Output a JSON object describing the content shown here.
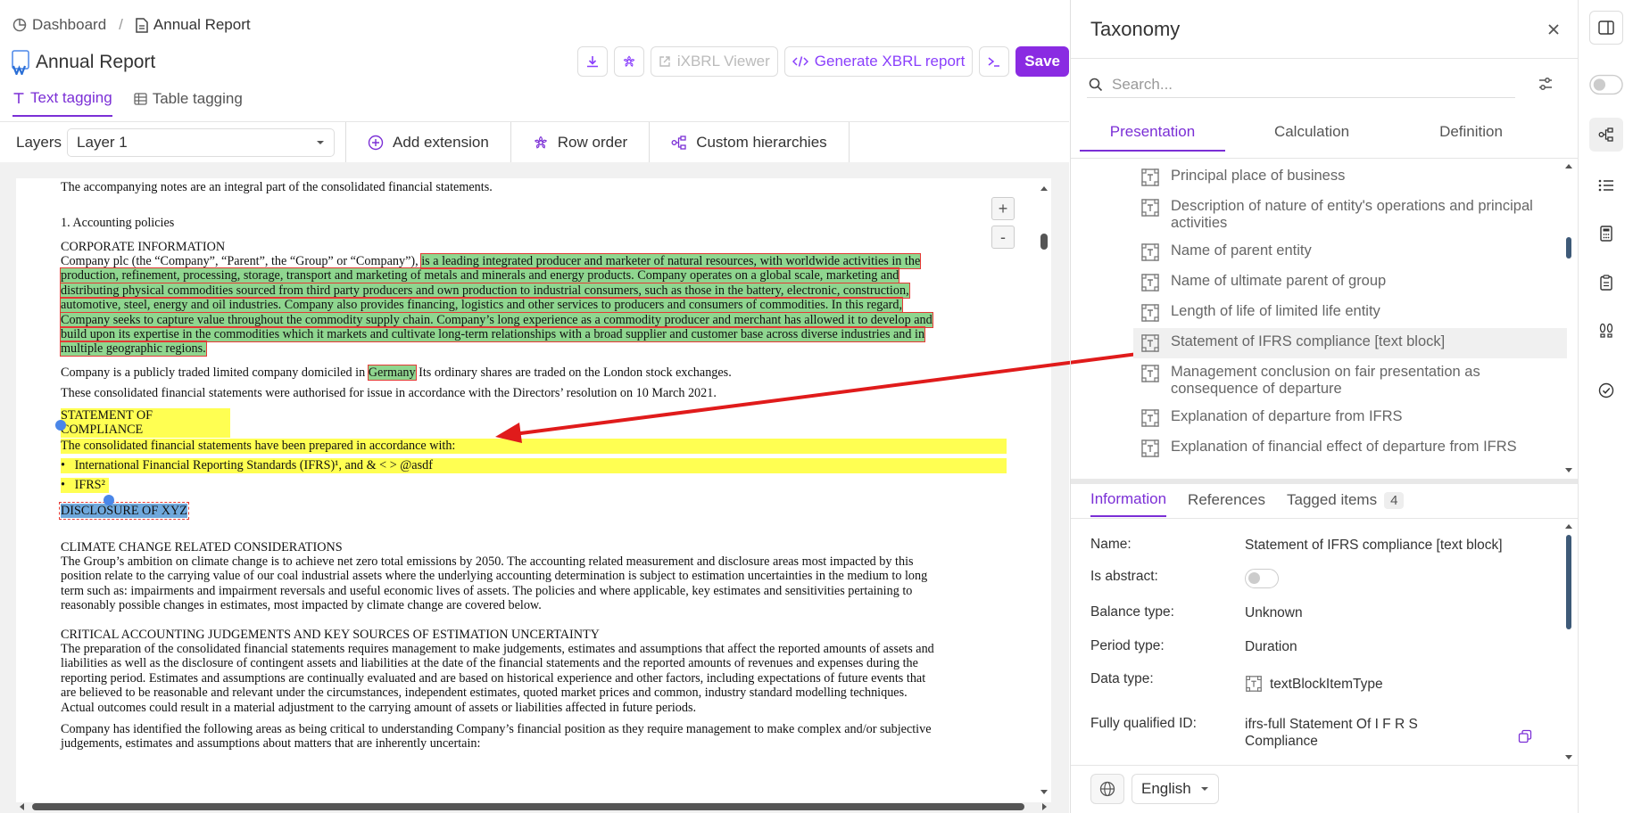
{
  "breadcrumb": {
    "home": "Dashboard",
    "separator": "/",
    "current": "Annual Report"
  },
  "header": {
    "title": "Annual Report"
  },
  "toolbar": {
    "download_icon": "download-icon",
    "settings_icon": "flower-icon",
    "ixbrl_label": "iXBRL Viewer",
    "generate_label": "Generate XBRL report",
    "terminal_icon": "terminal-icon",
    "save_label": "Save"
  },
  "tabs": [
    {
      "label": "Text tagging",
      "active": true
    },
    {
      "label": "Table tagging",
      "active": false
    }
  ],
  "layerbar": {
    "layers_label": "Layers",
    "layer_value": "Layer 1",
    "add_extension": "Add extension",
    "row_order": "Row order",
    "custom_hierarchies": "Custom hierarchies"
  },
  "document": {
    "p0": "The accompanying notes are an integral part of the consolidated financial statements.",
    "h1": "1. Accounting policies",
    "h_corp": "CORPORATE INFORMATION",
    "corp_pre": "Company plc (the “Company”, “Parent”, the “Group” or “Company”),",
    "corp_tag_l1": "is a leading integrated producer and marketer of natural resources, with worldwide activities in the",
    "corp_tag_l2": "production, refinement, processing, storage, transport and marketing of metals and minerals and energy products. Company operates on a global scale, marketing and",
    "corp_tag_l3": "distributing physical commodities sourced from third party producers and own production to industrial consumers, such as those in the battery, electronic, construction,",
    "corp_tag_l4": "automotive, steel, energy and oil industries. Company also provides financing, logistics and other services to producers and consumers of commodities. In this regard,",
    "corp_tag_l5": "Company seeks to capture value throughout the commodity supply chain. Company’s long experience as a commodity producer and merchant has allowed it to develop and",
    "corp_tag_l6": "build upon its expertise in the commodities which it markets and cultivate long-term relationships with a broad supplier and customer base across diverse industries and in",
    "corp_tag_l7": "multiple geographic regions.",
    "domicile_pre": "Company is a publicly traded limited company domiciled in",
    "domicile_tag": "Germany",
    "domicile_post": "Its ordinary shares are traded on the London stock exchanges.",
    "authorised": "These consolidated financial statements were authorised for issue in accordance with the Directors’ resolution on 10 March 2021.",
    "h_compliance": "STATEMENT OF COMPLIANCE",
    "compliance_l1": "The consolidated financial statements have been prepared in accordance with:",
    "compliance_b1": "International Financial Reporting Standards (IFRS)¹, and & < > @asdf",
    "compliance_b2": "IFRS²",
    "h_disclosure": "DISCLOSURE OF XYZ",
    "h_climate": "CLIMATE CHANGE RELATED CONSIDERATIONS",
    "climate_l1": "The Group’s ambition on climate change is to achieve net zero total emissions by 2050. The accounting related measurement and disclosure areas most impacted by this",
    "climate_l2": "position relate to the carrying value of our coal industrial assets where the underlying accounting determination is subject to estimation uncertainties in the medium to long",
    "climate_l3": "term such as: impairments and impairment reversals and useful economic lives of assets. The policies and where applicable, key estimates and sensitivities pertaining to",
    "climate_l4": "reasonably possible changes in estimates, most impacted by climate change are covered below.",
    "h_critical": "CRITICAL ACCOUNTING JUDGEMENTS AND KEY SOURCES OF ESTIMATION UNCERTAINTY",
    "critical_l1": "The preparation of the consolidated financial statements requires management to make judgements, estimates and assumptions that affect the reported amounts of assets and",
    "critical_l2": "liabilities as well as the disclosure of contingent assets and liabilities at the date of the financial statements and the reported amounts of revenues and expenses during the",
    "critical_l3": "reporting period. Estimates and assumptions are continually evaluated and are based on historical experience and other factors, including expectations of future events that",
    "critical_l4": "are believed to be reasonable and relevant under the circumstances, independent estimates, quoted market prices and common, industry standard modelling techniques.",
    "critical_l5": "Actual outcomes could result in a material adjustment to the carrying amount of assets or liabilities affected in future periods.",
    "identified_l1": "Company has identified the following areas as being critical to understanding Company’s financial position as they require management to make complex and/or subjective",
    "identified_l2": "judgements, estimates and assumptions about matters that are inherently uncertain:"
  },
  "zoom": {
    "in": "+",
    "out": "-"
  },
  "panel": {
    "title": "Taxonomy",
    "search_placeholder": "Search...",
    "tabs": [
      "Presentation",
      "Calculation",
      "Definition"
    ],
    "tree": [
      {
        "label": "Principal place of business",
        "selected": false
      },
      {
        "label": "Description of nature of entity's operations and principal activities",
        "selected": false
      },
      {
        "label": "Name of parent entity",
        "selected": false
      },
      {
        "label": "Name of ultimate parent of group",
        "selected": false
      },
      {
        "label": "Length of life of limited life entity",
        "selected": false
      },
      {
        "label": "Statement of IFRS compliance [text block]",
        "selected": true
      },
      {
        "label": "Management conclusion on fair presentation as consequence of departure",
        "selected": false
      },
      {
        "label": "Explanation of departure from IFRS",
        "selected": false
      },
      {
        "label": "Explanation of financial effect of departure from IFRS",
        "selected": false
      }
    ],
    "info_tabs": {
      "information": "Information",
      "references": "References",
      "tagged": "Tagged items",
      "tagged_count": "4"
    },
    "info": {
      "name_label": "Name:",
      "name_value": "Statement of IFRS compliance [text block]",
      "abstract_label": "Is abstract:",
      "abstract_value": false,
      "balance_label": "Balance type:",
      "balance_value": "Unknown",
      "period_label": "Period type:",
      "period_value": "Duration",
      "datatype_label": "Data type:",
      "datatype_value": "textBlockItemType",
      "fqid_label": "Fully qualified ID:",
      "fqid_l1": "ifrs-full Statement Of I F R S",
      "fqid_l2": "Compliance"
    },
    "language": "English"
  },
  "colors": {
    "accent": "#7b2fd6",
    "tag_green": "#8fd68f",
    "tag_yellow": "#ffff52",
    "tag_blue": "#6fa8dc",
    "arrow_red": "#e01b1b"
  }
}
